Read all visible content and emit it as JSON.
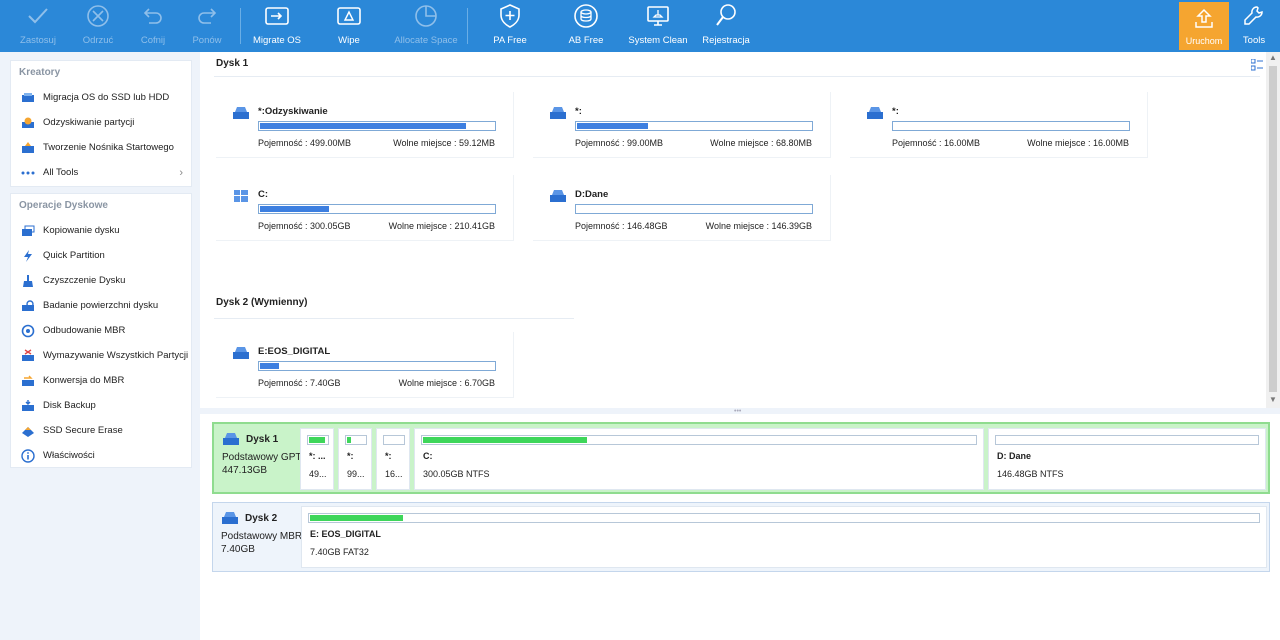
{
  "toolbar": {
    "buttons": [
      {
        "label": "Zastosuj",
        "icon": "check-icon",
        "enabled": false
      },
      {
        "label": "Odrzuć",
        "icon": "discard-icon",
        "enabled": false
      },
      {
        "label": "Cofnij",
        "icon": "undo-icon",
        "enabled": false
      },
      {
        "label": "Ponów",
        "icon": "redo-icon",
        "enabled": false
      },
      {
        "label": "Migrate OS",
        "icon": "migrate-os-icon",
        "enabled": true
      },
      {
        "label": "Wipe",
        "icon": "wipe-icon",
        "enabled": true
      },
      {
        "label": "Allocate Space",
        "icon": "allocate-space-icon",
        "enabled": false
      },
      {
        "label": "PA Free",
        "icon": "shield-icon",
        "enabled": true
      },
      {
        "label": "AB Free",
        "icon": "backup-icon",
        "enabled": true
      },
      {
        "label": "System Clean",
        "icon": "system-clean-icon",
        "enabled": true
      },
      {
        "label": "Rejestracja",
        "icon": "search-key-icon",
        "enabled": true
      }
    ],
    "launch_label": "Uruchom",
    "tools_label": "Tools",
    "accent": "#2b88d8",
    "launch_color": "#f5a530"
  },
  "sidebar": {
    "wizards": {
      "title": "Kreatory",
      "items": [
        {
          "label": "Migracja OS do SSD lub HDD",
          "icon": "migrate-icon"
        },
        {
          "label": "Odzyskiwanie partycji",
          "icon": "partition-recovery-icon"
        },
        {
          "label": "Tworzenie Nośnika Startowego",
          "icon": "bootable-media-icon"
        },
        {
          "label": "All Tools",
          "icon": "more-icon"
        }
      ]
    },
    "disk_ops": {
      "title": "Operacje Dyskowe",
      "items": [
        {
          "label": "Kopiowanie dysku",
          "icon": "copy-disk-icon"
        },
        {
          "label": "Quick Partition",
          "icon": "quick-partition-icon"
        },
        {
          "label": "Czyszczenie Dysku",
          "icon": "wipe-disk-icon"
        },
        {
          "label": "Badanie powierzchni dysku",
          "icon": "surface-test-icon"
        },
        {
          "label": "Odbudowanie MBR",
          "icon": "rebuild-mbr-icon"
        },
        {
          "label": "Wymazywanie Wszystkich Partycji",
          "icon": "delete-all-icon"
        },
        {
          "label": "Konwersja do MBR",
          "icon": "convert-icon"
        },
        {
          "label": "Disk Backup",
          "icon": "disk-backup-icon"
        },
        {
          "label": "SSD Secure Erase",
          "icon": "ssd-erase-icon"
        },
        {
          "label": "Właściwości",
          "icon": "info-icon"
        }
      ]
    }
  },
  "main": {
    "disk1_title": "Dysk 1",
    "disk2_title": "Dysk 2 (Wymienny)",
    "cap_label": "Pojemność : ",
    "free_label": "Wolne miejsce : ",
    "disk1_partitions": [
      {
        "name": "*:Odzyskiwanie",
        "capacity": "499.00MB",
        "free": "59.12MB",
        "used_fraction": 0.88,
        "icon": "drive-icon"
      },
      {
        "name": "*:",
        "capacity": "99.00MB",
        "free": "68.80MB",
        "used_fraction": 0.31,
        "icon": "drive-icon"
      },
      {
        "name": "*:",
        "capacity": "16.00MB",
        "free": "16.00MB",
        "used_fraction": 0.0,
        "icon": "drive-icon"
      },
      {
        "name": "C:",
        "capacity": "300.05GB",
        "free": "210.41GB",
        "used_fraction": 0.3,
        "icon": "windows-icon"
      },
      {
        "name": "D:Dane",
        "capacity": "146.48GB",
        "free": "146.39GB",
        "used_fraction": 0.0,
        "icon": "drive-icon"
      }
    ],
    "disk2_partitions": [
      {
        "name": "E:EOS_DIGITAL",
        "capacity": "7.40GB",
        "free": "6.70GB",
        "used_fraction": 0.09,
        "icon": "drive-icon"
      }
    ]
  },
  "map": {
    "disk1": {
      "name": "Dysk 1",
      "type": "Podstawowy GPT",
      "size": "447.13GB",
      "segments": [
        {
          "name": "*: ...",
          "info": "49...",
          "used_fraction": 0.88
        },
        {
          "name": "*:",
          "info": "99...",
          "used_fraction": 0.31
        },
        {
          "name": "*:",
          "info": "16...",
          "used_fraction": 0.0
        },
        {
          "name": "C:",
          "info": "300.05GB NTFS",
          "used_fraction": 0.3
        },
        {
          "name": "D: Dane",
          "info": "146.48GB NTFS",
          "used_fraction": 0.0
        }
      ]
    },
    "disk2": {
      "name": "Dysk 2",
      "type": "Podstawowy MBR",
      "size": "7.40GB",
      "segments": [
        {
          "name": "E: EOS_DIGITAL",
          "info": "7.40GB FAT32",
          "used_fraction": 0.1
        }
      ]
    }
  }
}
